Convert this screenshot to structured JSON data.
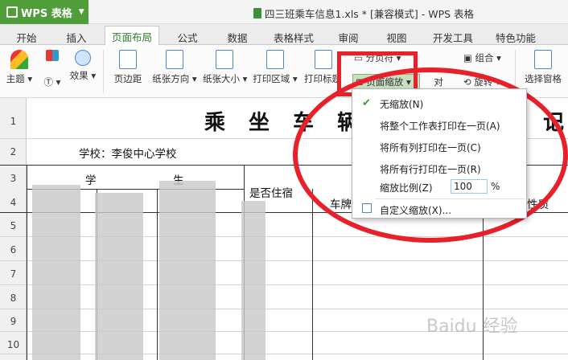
{
  "app": {
    "brand": "WPS 表格",
    "window_title": "四三班乘车信息1.xls * [兼容模式] - WPS 表格"
  },
  "tabs": [
    "开始",
    "插入",
    "页面布局",
    "公式",
    "数据",
    "表格样式",
    "审阅",
    "视图",
    "开发工具",
    "特色功能"
  ],
  "ribbon": {
    "theme": "主题",
    "font": "T",
    "effect": "效果",
    "margin": "页边距",
    "orientation": "纸张方向",
    "size": "纸张大小",
    "print_area": "打印区域",
    "print_title": "打印标题",
    "page_break": "分页符",
    "page_zoom": "页面缩放",
    "align": "对",
    "group": "组合",
    "rotate": "旋转",
    "selection_pane": "选择窗格"
  },
  "rows": [
    "1",
    "2",
    "3",
    "4",
    "5",
    "6",
    "7",
    "8",
    "9",
    "10"
  ],
  "sheet": {
    "title_left": "乘 坐 车 辆",
    "title_right": "记",
    "school": "学校：李俊中心学校",
    "h_xue": "学",
    "h_sheng": "生",
    "h_boarding": "是否住宿",
    "h_plate": "车牌",
    "h_nature": "性质"
  },
  "dropdown": {
    "items": [
      "无缩放(N)",
      "将整个工作表打印在一页(A)",
      "将所有列打印在一页(C)",
      "将所有行打印在一页(R)"
    ],
    "scale_label": "缩放比例(Z)",
    "scale_value": "100",
    "scale_unit": "%",
    "custom": "自定义缩放(X)..."
  },
  "watermark": "Baidu 经验",
  "colors": {
    "accent_green": "#4f9e3a",
    "annotation_red": "#e8202a"
  }
}
